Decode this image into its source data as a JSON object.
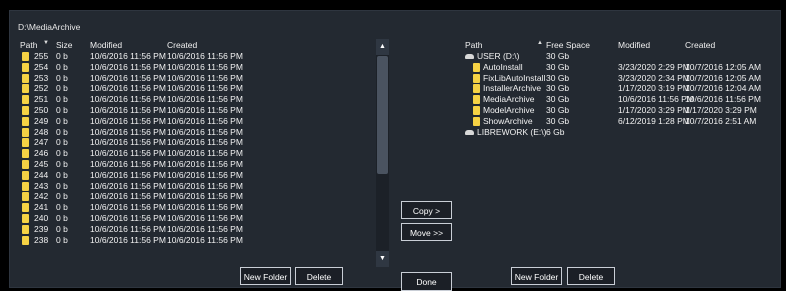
{
  "current_path": "D:\\MediaArchive",
  "left_pane": {
    "headers": {
      "path": "Path",
      "size": "Size",
      "modified": "Modified",
      "created": "Created"
    },
    "rows": [
      {
        "name": "255",
        "size": "0 b",
        "modified": "10/6/2016 11:56 PM",
        "created": "10/6/2016 11:56 PM"
      },
      {
        "name": "254",
        "size": "0 b",
        "modified": "10/6/2016 11:56 PM",
        "created": "10/6/2016 11:56 PM"
      },
      {
        "name": "253",
        "size": "0 b",
        "modified": "10/6/2016 11:56 PM",
        "created": "10/6/2016 11:56 PM"
      },
      {
        "name": "252",
        "size": "0 b",
        "modified": "10/6/2016 11:56 PM",
        "created": "10/6/2016 11:56 PM"
      },
      {
        "name": "251",
        "size": "0 b",
        "modified": "10/6/2016 11:56 PM",
        "created": "10/6/2016 11:56 PM"
      },
      {
        "name": "250",
        "size": "0 b",
        "modified": "10/6/2016 11:56 PM",
        "created": "10/6/2016 11:56 PM"
      },
      {
        "name": "249",
        "size": "0 b",
        "modified": "10/6/2016 11:56 PM",
        "created": "10/6/2016 11:56 PM"
      },
      {
        "name": "248",
        "size": "0 b",
        "modified": "10/6/2016 11:56 PM",
        "created": "10/6/2016 11:56 PM"
      },
      {
        "name": "247",
        "size": "0 b",
        "modified": "10/6/2016 11:56 PM",
        "created": "10/6/2016 11:56 PM"
      },
      {
        "name": "246",
        "size": "0 b",
        "modified": "10/6/2016 11:56 PM",
        "created": "10/6/2016 11:56 PM"
      },
      {
        "name": "245",
        "size": "0 b",
        "modified": "10/6/2016 11:56 PM",
        "created": "10/6/2016 11:56 PM"
      },
      {
        "name": "244",
        "size": "0 b",
        "modified": "10/6/2016 11:56 PM",
        "created": "10/6/2016 11:56 PM"
      },
      {
        "name": "243",
        "size": "0 b",
        "modified": "10/6/2016 11:56 PM",
        "created": "10/6/2016 11:56 PM"
      },
      {
        "name": "242",
        "size": "0 b",
        "modified": "10/6/2016 11:56 PM",
        "created": "10/6/2016 11:56 PM"
      },
      {
        "name": "241",
        "size": "0 b",
        "modified": "10/6/2016 11:56 PM",
        "created": "10/6/2016 11:56 PM"
      },
      {
        "name": "240",
        "size": "0 b",
        "modified": "10/6/2016 11:56 PM",
        "created": "10/6/2016 11:56 PM"
      },
      {
        "name": "239",
        "size": "0 b",
        "modified": "10/6/2016 11:56 PM",
        "created": "10/6/2016 11:56 PM"
      },
      {
        "name": "238",
        "size": "0 b",
        "modified": "10/6/2016 11:56 PM",
        "created": "10/6/2016 11:56 PM"
      }
    ],
    "new_folder_label": "New Folder",
    "delete_label": "Delete"
  },
  "right_pane": {
    "headers": {
      "path": "Path",
      "free_space": "Free Space",
      "modified": "Modified",
      "created": "Created"
    },
    "rows": [
      {
        "name": "USER (D:\\)",
        "free": "30 Gb",
        "modified": "",
        "created": "",
        "icon": "drive-icon",
        "indent": 0
      },
      {
        "name": "AutoInstall",
        "free": "30 Gb",
        "modified": "3/23/2020 2:29 PM",
        "created": "10/7/2016 12:05 AM",
        "icon": "folder-icon",
        "indent": 1
      },
      {
        "name": "FixLibAutoInstall",
        "free": "30 Gb",
        "modified": "3/23/2020 2:34 PM",
        "created": "10/7/2016 12:05 AM",
        "icon": "folder-icon",
        "indent": 1
      },
      {
        "name": "InstallerArchive",
        "free": "30 Gb",
        "modified": "1/17/2020 3:19 PM",
        "created": "10/7/2016 12:04 AM",
        "icon": "folder-icon",
        "indent": 1
      },
      {
        "name": "MediaArchive",
        "free": "30 Gb",
        "modified": "10/6/2016 11:56 PM",
        "created": "10/6/2016 11:56 PM",
        "icon": "folder-icon",
        "indent": 1
      },
      {
        "name": "ModelArchive",
        "free": "30 Gb",
        "modified": "1/17/2020 3:29 PM",
        "created": "1/17/2020 3:29 PM",
        "icon": "folder-icon",
        "indent": 1
      },
      {
        "name": "ShowArchive",
        "free": "30 Gb",
        "modified": "6/12/2019 1:28 PM",
        "created": "10/7/2016 2:51 AM",
        "icon": "folder-icon",
        "indent": 1
      },
      {
        "name": "LIBREWORK (E:\\)",
        "free": "6 Gb",
        "modified": "",
        "created": "",
        "icon": "drive-icon",
        "indent": 0
      }
    ],
    "new_folder_label": "New Folder",
    "delete_label": "Delete"
  },
  "center": {
    "copy_label": "Copy >",
    "move_label": "Move >>",
    "done_label": "Done"
  }
}
